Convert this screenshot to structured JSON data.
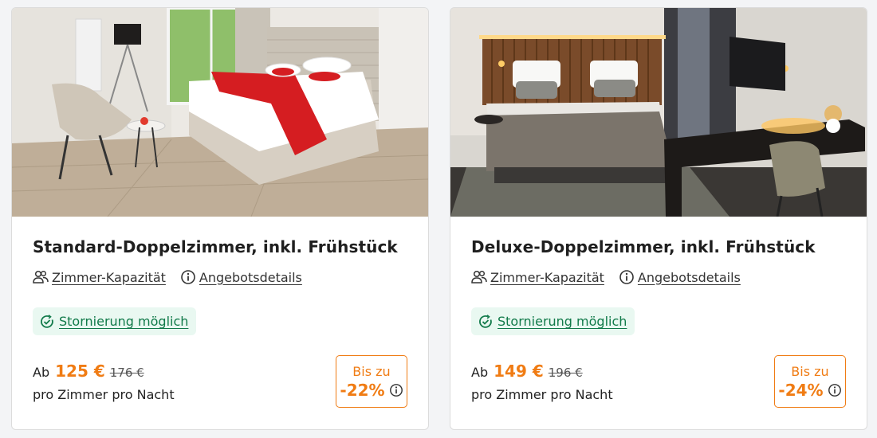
{
  "rooms": [
    {
      "title": "Standard-Doppelzimmer, inkl. Frühstück",
      "capacity_label": "Zimmer-Kapazität",
      "offer_label": "Angebotsdetails",
      "cancellation_label": "Stornierung möglich",
      "price_prefix": "Ab",
      "price_now": "125 €",
      "price_old": "176 €",
      "per_night": "pro Zimmer pro Nacht",
      "discount_upto": "Bis zu",
      "discount_pct": "-22%",
      "photo_icon": "hotel-room-photo"
    },
    {
      "title": "Deluxe-Doppelzimmer, inkl. Frühstück",
      "capacity_label": "Zimmer-Kapazität",
      "offer_label": "Angebotsdetails",
      "cancellation_label": "Stornierung möglich",
      "price_prefix": "Ab",
      "price_now": "149 €",
      "price_old": "196 €",
      "per_night": "pro Zimmer pro Nacht",
      "discount_upto": "Bis zu",
      "discount_pct": "-24%",
      "photo_icon": "hotel-room-photo"
    }
  ],
  "colors": {
    "accent_orange": "#f07c14",
    "cancel_green": "#117a4a",
    "cancel_bg": "#e9f8f1"
  }
}
